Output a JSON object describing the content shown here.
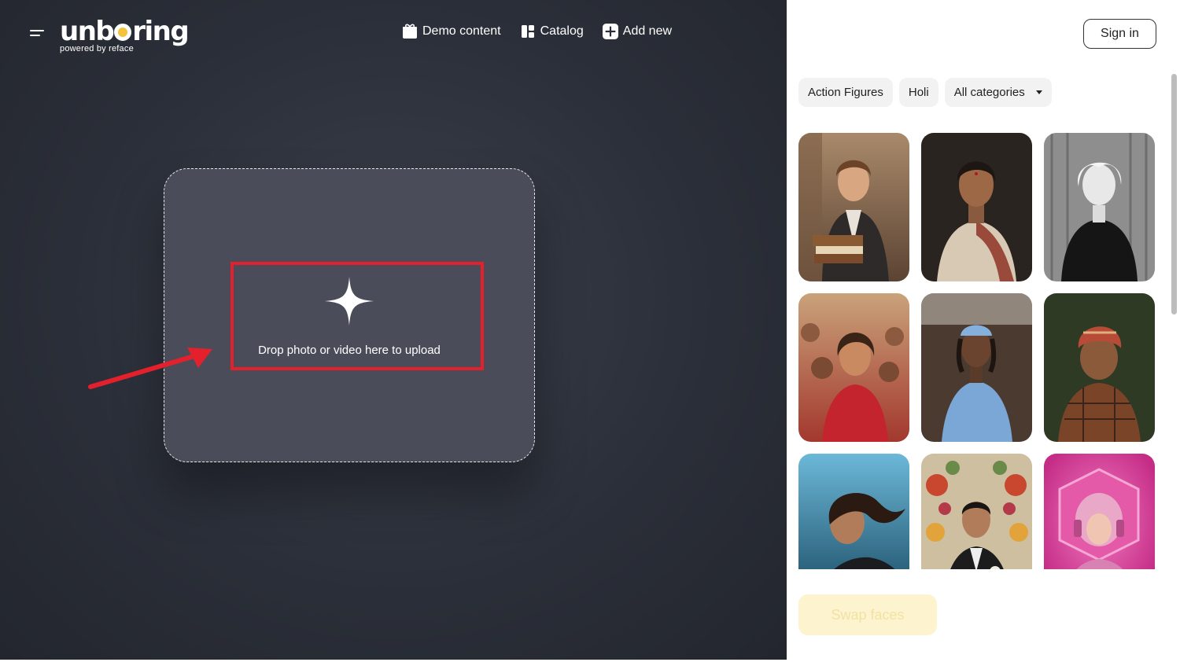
{
  "app": {
    "logo_pre": "unb",
    "logo_post": "ring",
    "logo_sub": "powered by reface",
    "logo_accent": "#f5c23c"
  },
  "nav": {
    "menu_icon": "hamburger-icon",
    "items": [
      {
        "label": "Demo content",
        "icon": "gift-icon"
      },
      {
        "label": "Catalog",
        "icon": "catalog-icon"
      },
      {
        "label": "Add new",
        "icon": "plus-square-icon"
      }
    ]
  },
  "upload": {
    "text": "Drop photo or video here to upload",
    "icon": "sparkle-plus-icon",
    "highlight_color": "#e3202b"
  },
  "account": {
    "sign_in": "Sign in"
  },
  "filters": {
    "chips": [
      {
        "label": "Action Figures"
      },
      {
        "label": "Holi"
      },
      {
        "label": "All categories",
        "dropdown": true
      }
    ]
  },
  "gallery": {
    "items": [
      {
        "name": "young-man-with-books"
      },
      {
        "name": "woman-in-saree"
      },
      {
        "name": "bw-portrait-woman"
      },
      {
        "name": "holi-festival-woman"
      },
      {
        "name": "flight-attendant"
      },
      {
        "name": "man-in-turban"
      },
      {
        "name": "surfer-woman"
      },
      {
        "name": "man-with-flowers"
      },
      {
        "name": "pink-astronaut"
      }
    ]
  },
  "actions": {
    "swap_label": "Swap faces"
  }
}
